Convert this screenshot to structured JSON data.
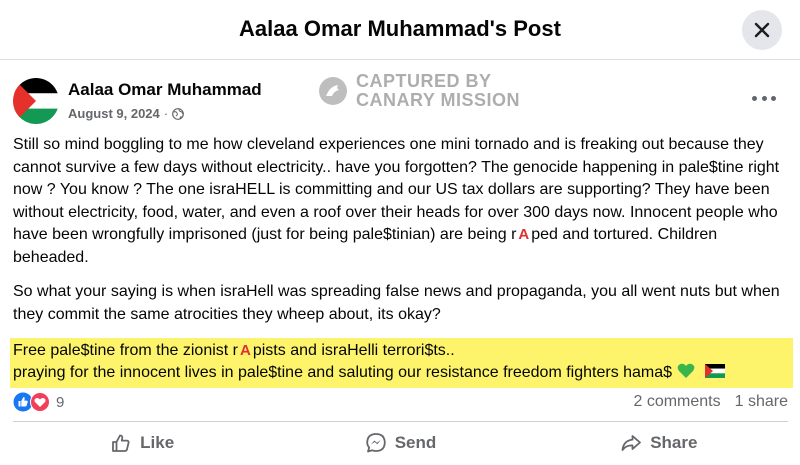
{
  "header": {
    "title": "Aalaa Omar Muhammad's Post"
  },
  "post": {
    "author": "Aalaa Omar Muhammad",
    "date": "August 9, 2024",
    "meta_separator": "·",
    "watermark": {
      "line1": "CAPTURED BY",
      "line2": "CANARY MISSION"
    },
    "paragraph1_a": "Still so mind boggling to me how cleveland experiences one mini tornado and is freaking out because they cannot survive a few days without electricity.. have you forgotten? The genocide happening in pale$tine right now ? You know ? The one israHELL is committing and our US tax dollars are supporting? They have been without electricity, food, water, and even a roof over their heads for over 300 days now. Innocent people who have been wrongfully imprisoned (just for being pale$tinian) are being r",
    "paragraph1_letter": "A",
    "paragraph1_b": "ped and tortured. Children beheaded.",
    "paragraph2": "So what your saying is when israHell was spreading false news and propaganda, you all went nuts but when they commit the same atrocities they wheep about, its okay?",
    "highlight_line1_a": "Free pale$tine from the zionist r",
    "highlight_line1_letter": "A",
    "highlight_line1_b": "pists and israHelli terrori$ts..",
    "highlight_line2": "praying for the innocent lives in pale$tine and saluting our resistance freedom fighters hama$"
  },
  "stats": {
    "reaction_count": "9",
    "comments": "2 comments",
    "shares": "1 share"
  },
  "actions": {
    "like": "Like",
    "send": "Send",
    "share": "Share"
  },
  "colors": {
    "highlight": "#fdf46b",
    "like_blue": "#1877f2",
    "love_red": "#f33e58",
    "close_bg": "#e4e6eb",
    "muted_text": "#65676b"
  },
  "icons": [
    "close-icon",
    "globe-icon",
    "more-icon",
    "like-reaction-icon",
    "love-reaction-icon",
    "green-heart-icon",
    "flag-icon",
    "like-icon",
    "send-icon",
    "share-icon",
    "canary-logo-icon"
  ]
}
